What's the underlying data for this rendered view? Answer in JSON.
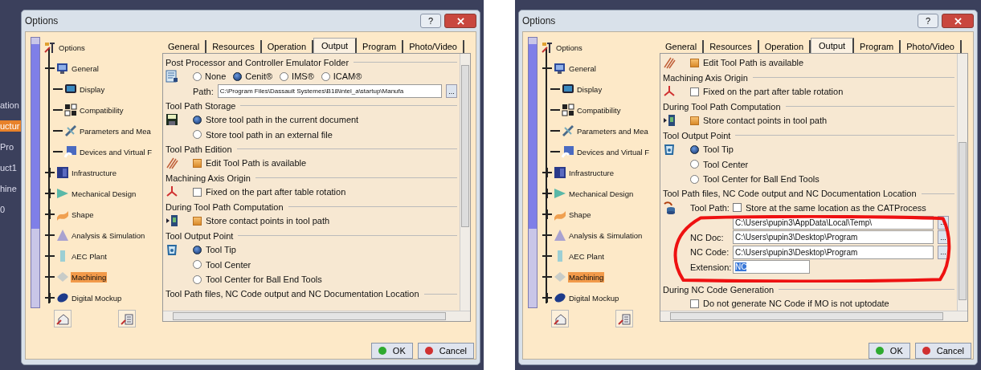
{
  "background_fragments": [
    {
      "text": "ation",
      "selected": false
    },
    {
      "text": "uctur",
      "selected": true
    },
    {
      "text": "Pro",
      "selected": false
    },
    {
      "text": "uct1",
      "selected": false
    },
    {
      "text": "hine",
      "selected": false
    },
    {
      "text": "0",
      "selected": false
    }
  ],
  "dialogs": [
    {
      "title": "Options",
      "help": "?",
      "tree": {
        "label": "Options",
        "children": [
          {
            "label": "General",
            "expanded": true,
            "selected": false,
            "children": [
              {
                "label": "Display",
                "selected": false
              },
              {
                "label": "Compatibility",
                "selected": false
              },
              {
                "label": "Parameters and Mea",
                "selected": false
              },
              {
                "label": "Devices and Virtual F",
                "selected": false
              }
            ]
          },
          {
            "label": "Infrastructure",
            "expanded": false,
            "selected": false
          },
          {
            "label": "Mechanical Design",
            "expanded": false,
            "selected": false
          },
          {
            "label": "Shape",
            "expanded": false,
            "selected": false
          },
          {
            "label": "Analysis & Simulation",
            "selected": false
          },
          {
            "label": "AEC Plant",
            "selected": false
          },
          {
            "label": "Machining",
            "selected": true
          },
          {
            "label": "Digital Mockup",
            "expanded": false,
            "selected": false
          }
        ]
      },
      "tabs": [
        {
          "label": "General",
          "selected": false
        },
        {
          "label": "Resources",
          "selected": false
        },
        {
          "label": "Operation",
          "selected": false
        },
        {
          "label": "Output",
          "selected": true
        },
        {
          "label": "Program",
          "selected": false
        },
        {
          "label": "Photo/Video",
          "selected": false
        }
      ],
      "sections": [
        {
          "heading": "Post Processor and Controller Emulator Folder",
          "rows": [
            {
              "kind": "radios",
              "options": [
                {
                  "label": "None",
                  "selected": false
                },
                {
                  "label": "Cenit®",
                  "selected": true
                },
                {
                  "label": "IMS®",
                  "selected": false
                },
                {
                  "label": "ICAM®",
                  "selected": false
                }
              ]
            },
            {
              "kind": "path",
              "label": "Path:",
              "value": "C:\\Program Files\\Dassault Systemes\\B18\\intel_a\\startup\\Manufa",
              "browse": "..."
            }
          ]
        },
        {
          "heading": "Tool Path Storage",
          "rows": [
            {
              "kind": "radio",
              "label": "Store tool path in the current document",
              "selected": true
            },
            {
              "kind": "radio",
              "label": "Store tool path in an external file",
              "selected": false
            }
          ]
        },
        {
          "heading": "Tool Path Edition",
          "rows": [
            {
              "kind": "checkbox",
              "label": "Edit Tool Path is available",
              "checked": true
            }
          ]
        },
        {
          "heading": "Machining Axis Origin",
          "rows": [
            {
              "kind": "checkbox",
              "label": "Fixed on the part after table rotation",
              "checked": false
            }
          ]
        },
        {
          "heading": "During Tool Path Computation",
          "rows": [
            {
              "kind": "checkbox",
              "label": "Store contact points in tool path",
              "checked": true
            }
          ]
        },
        {
          "heading": "Tool Output Point",
          "rows": [
            {
              "kind": "radio",
              "label": "Tool Tip",
              "selected": true
            },
            {
              "kind": "radio",
              "label": "Tool Center",
              "selected": false
            },
            {
              "kind": "radio",
              "label": "Tool Center for Ball End Tools",
              "selected": false
            }
          ]
        },
        {
          "heading": "Tool Path files, NC Code output and NC Documentation Location"
        }
      ],
      "buttons": [
        {
          "label": "OK",
          "kind": "ok"
        },
        {
          "label": "Cancel",
          "kind": "cancel"
        }
      ]
    },
    {
      "title": "Options",
      "help": "?",
      "tree": {
        "label": "Options",
        "children": [
          {
            "label": "General",
            "expanded": true,
            "selected": false,
            "children": [
              {
                "label": "Display",
                "selected": false
              },
              {
                "label": "Compatibility",
                "selected": false
              },
              {
                "label": "Parameters and Mea",
                "selected": false
              },
              {
                "label": "Devices and Virtual F",
                "selected": false
              }
            ]
          },
          {
            "label": "Infrastructure",
            "expanded": false,
            "selected": false
          },
          {
            "label": "Mechanical Design",
            "expanded": false,
            "selected": false
          },
          {
            "label": "Shape",
            "expanded": false,
            "selected": false
          },
          {
            "label": "Analysis & Simulation",
            "selected": false
          },
          {
            "label": "AEC Plant",
            "selected": false
          },
          {
            "label": "Machining",
            "selected": true
          },
          {
            "label": "Digital Mockup",
            "expanded": false,
            "selected": false
          }
        ]
      },
      "tabs": [
        {
          "label": "General",
          "selected": false
        },
        {
          "label": "Resources",
          "selected": false
        },
        {
          "label": "Operation",
          "selected": false
        },
        {
          "label": "Output",
          "selected": true
        },
        {
          "label": "Program",
          "selected": false
        },
        {
          "label": "Photo/Video",
          "selected": false
        }
      ],
      "sections": [
        {
          "rows": [
            {
              "kind": "checkbox",
              "label": "Edit Tool Path is available",
              "checked": true
            }
          ]
        },
        {
          "heading": "Machining Axis Origin",
          "rows": [
            {
              "kind": "checkbox",
              "label": "Fixed on the part after table rotation",
              "checked": false
            }
          ]
        },
        {
          "heading": "During Tool Path Computation",
          "rows": [
            {
              "kind": "checkbox",
              "label": "Store contact points in tool path",
              "checked": true
            }
          ]
        },
        {
          "heading": "Tool Output Point",
          "rows": [
            {
              "kind": "radio",
              "label": "Tool Tip",
              "selected": true
            },
            {
              "kind": "radio",
              "label": "Tool Center",
              "selected": false
            },
            {
              "kind": "radio",
              "label": "Tool Center for Ball End Tools",
              "selected": false
            }
          ]
        },
        {
          "heading": "Tool Path files, NC Code output and NC Documentation Location",
          "circled": true,
          "rows": [
            {
              "kind": "checkbox",
              "prefix": "Tool Path:",
              "label": "Store at the same location as the CATProcess",
              "checked": false
            },
            {
              "kind": "path",
              "value": "C:\\Users\\pupin3\\AppData\\Local\\Temp\\",
              "browse": "..."
            },
            {
              "kind": "path",
              "label": "NC Doc:",
              "value": "C:\\Users\\pupin3\\Desktop\\Program",
              "browse": "..."
            },
            {
              "kind": "path",
              "label": "NC Code:",
              "value": "C:\\Users\\pupin3\\Desktop\\Program",
              "browse": "..."
            },
            {
              "kind": "text",
              "label": "Extension:",
              "value": "NC",
              "highlighted": true
            }
          ]
        },
        {
          "heading": "During NC Code Generation",
          "rows": [
            {
              "kind": "checkbox",
              "label": "Do not generate NC Code if MO is not uptodate",
              "checked": false
            }
          ]
        }
      ],
      "buttons": [
        {
          "label": "OK",
          "kind": "ok"
        },
        {
          "label": "Cancel",
          "kind": "cancel"
        }
      ]
    }
  ]
}
